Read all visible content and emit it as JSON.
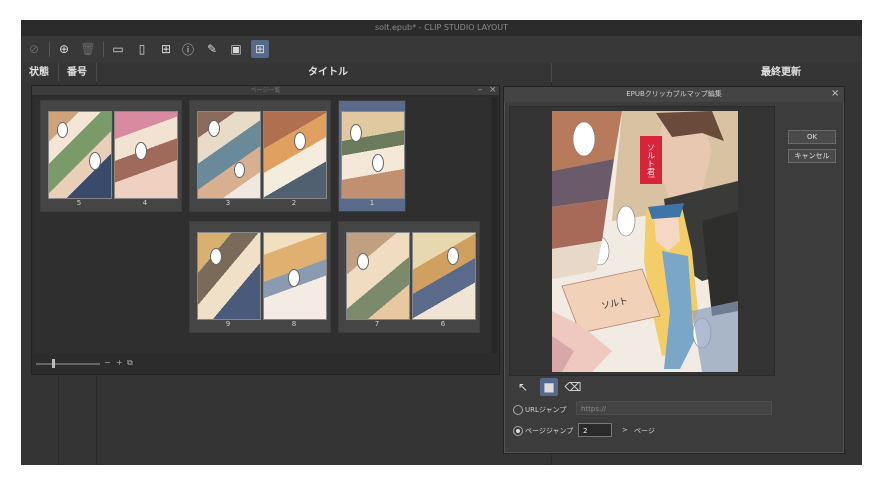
{
  "window": {
    "title": "solt.epub* - CLIP STUDIO LAYOUT"
  },
  "toolbar": {
    "icons": [
      "zoom-icon",
      "add-icon",
      "trash-icon",
      "page-view-icon",
      "single-page-icon",
      "layout-icon",
      "info-icon",
      "pen-icon",
      "image-icon",
      "grid-view-icon"
    ]
  },
  "columns": {
    "status": "状態",
    "number": "番号",
    "title": "タイトル",
    "updated": "最終更新"
  },
  "page_panel": {
    "title": "ページ一覧",
    "spreads": [
      {
        "left_num": "5",
        "right_num": "4"
      },
      {
        "left_num": "3",
        "right_num": "2"
      },
      {
        "single_num": "1"
      },
      {
        "left_num": "9",
        "right_num": "8"
      },
      {
        "left_num": "7",
        "right_num": "6"
      }
    ],
    "zoom_minus": "−",
    "zoom_plus": "+"
  },
  "dialog": {
    "title": "EPUBクリッカブルマップ編集",
    "ok_label": "OK",
    "cancel_label": "キャンセル",
    "art_text": {
      "red_label": "ソルト君!",
      "card_text": "ソルト"
    },
    "url_jump_label": "URLジャンプ",
    "url_placeholder": "https://",
    "page_jump_label": "ページジャンプ",
    "page_value": "2",
    "page_arrow": ">",
    "page_suffix": "ページ"
  }
}
